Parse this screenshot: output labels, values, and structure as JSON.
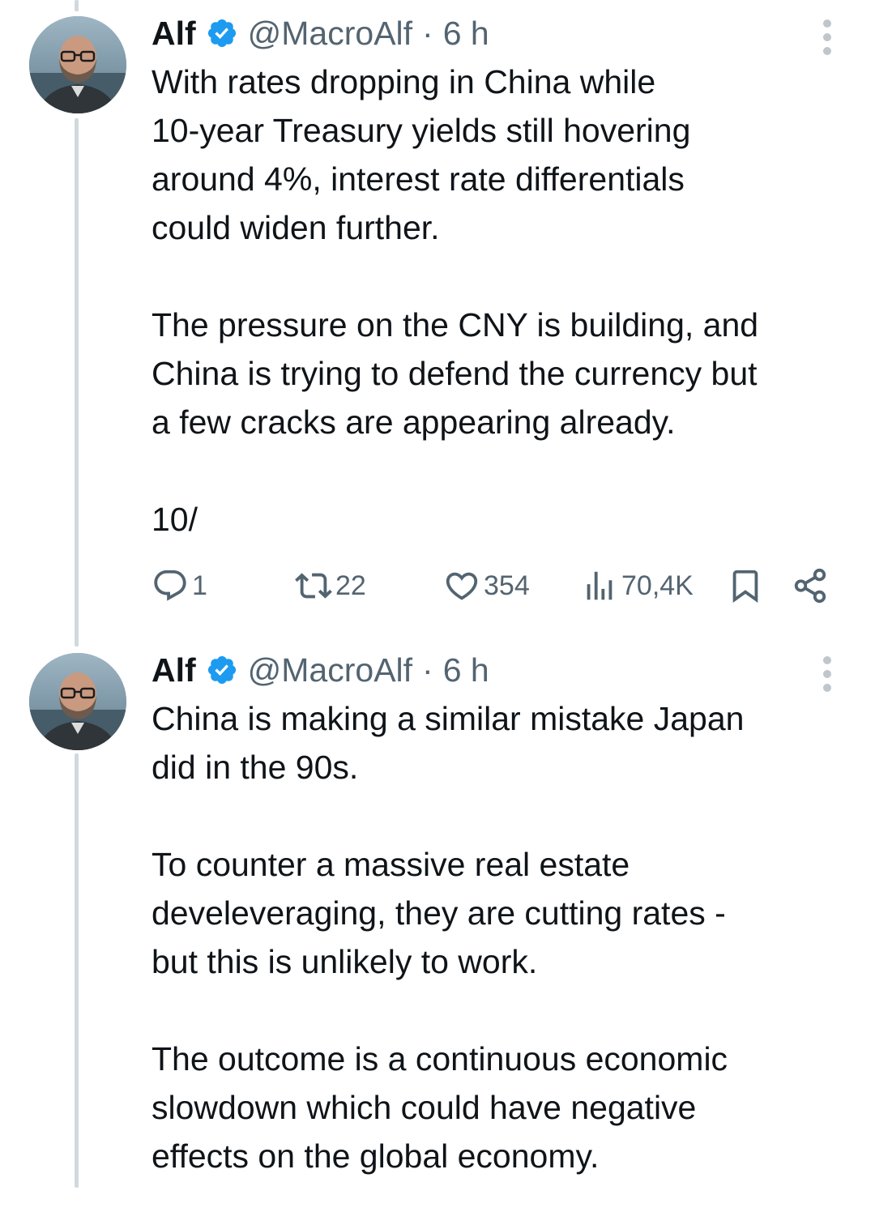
{
  "tweets": [
    {
      "author": {
        "name": "Alf",
        "handle": "@MacroAlf",
        "separator": "·",
        "time": "6 h"
      },
      "paragraphs": [
        "With rates dropping in China while\n10-year Treasury yields still hovering\naround 4%, interest rate differentials\ncould widen further.",
        "The pressure on the CNY is building, and\nChina is trying to defend the currency but\na few cracks are appearing already.",
        "10/"
      ],
      "actions": {
        "replies": "1",
        "retweets": "22",
        "likes": "354",
        "views": "70,4K"
      }
    },
    {
      "author": {
        "name": "Alf",
        "handle": "@MacroAlf",
        "separator": "·",
        "time": "6 h"
      },
      "paragraphs": [
        "China is making a similar mistake Japan\ndid in the 90s.",
        "To counter a massive real estate\ndeveleveraging, they are cutting rates -\nbut this is unlikely to work.",
        "The outcome is a continuous economic\nslowdown which could have negative\neffects on the global economy."
      ]
    }
  ],
  "colors": {
    "verified": "#1d9bf0",
    "secondary_text": "#536471",
    "thread_line": "#cfd9de"
  },
  "icons": {
    "reply": "reply-icon",
    "retweet": "retweet-icon",
    "like": "heart-icon",
    "views": "views-bar-icon",
    "bookmark": "bookmark-icon",
    "share": "share-icon",
    "more": "more-vertical-icon",
    "verified": "verified-badge-icon"
  }
}
